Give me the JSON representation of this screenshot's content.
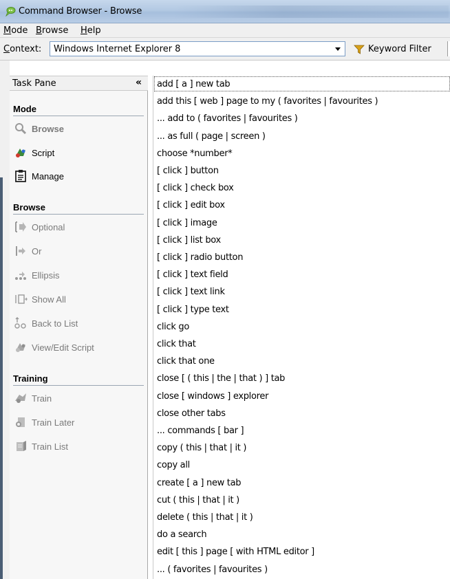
{
  "window": {
    "title": "Command Browser - Browse"
  },
  "menubar": {
    "items": [
      {
        "label": "Mode",
        "accel": "M",
        "rest": "ode"
      },
      {
        "label": "Browse",
        "accel": "B",
        "rest": "rowse"
      },
      {
        "label": "Help",
        "accel": "H",
        "rest": "elp"
      }
    ]
  },
  "contextbar": {
    "label_accel": "C",
    "label_rest": "ontext:",
    "selected_value": "Windows Internet Explorer 8",
    "filter_label": "Keyword Filter"
  },
  "taskpane": {
    "header": "Task Pane",
    "collapse_glyph": "«",
    "sections": [
      {
        "title": "Mode",
        "items": [
          {
            "label": "Browse",
            "icon": "magnifier-icon",
            "state": "bold-disabled"
          },
          {
            "label": "Script",
            "icon": "script-icon",
            "state": "enabled"
          },
          {
            "label": "Manage",
            "icon": "manage-icon",
            "state": "enabled"
          }
        ]
      },
      {
        "title": "Browse",
        "items": [
          {
            "label": "Optional",
            "icon": "optional-icon",
            "state": "disabled"
          },
          {
            "label": "Or",
            "icon": "or-icon",
            "state": "disabled"
          },
          {
            "label": "Ellipsis",
            "icon": "ellipsis-icon",
            "state": "disabled"
          },
          {
            "label": "Show All",
            "icon": "show-all-icon",
            "state": "disabled"
          },
          {
            "label": "Back to List",
            "icon": "back-to-list-icon",
            "state": "disabled"
          },
          {
            "label": "View/Edit Script",
            "icon": "view-edit-script-icon",
            "state": "disabled"
          }
        ]
      },
      {
        "title": "Training",
        "items": [
          {
            "label": "Train",
            "icon": "train-icon",
            "state": "disabled"
          },
          {
            "label": "Train Later",
            "icon": "train-later-icon",
            "state": "disabled"
          },
          {
            "label": "Train List",
            "icon": "train-list-icon",
            "state": "disabled"
          }
        ]
      }
    ]
  },
  "commands": [
    "add [ a ] new tab",
    "add this [ web ] page to my ( favorites | favourites )",
    "... add to ( favorites | favourites )",
    "... as full ( page | screen )",
    "choose *number*",
    "[ click ] button",
    "[ click ] check box",
    "[ click ] edit box",
    "[ click ] image",
    "[ click ] list box",
    "[ click ] radio button",
    "[ click ] text field",
    "[ click ] text link",
    "[ click ] type text",
    "click go",
    "click that",
    "click that one",
    "close [ ( this | the | that ) ] tab",
    "close [ windows ] explorer",
    "close other tabs",
    "... commands [ bar ]",
    "copy ( this | that | it )",
    "copy all",
    "create [ a ] new tab",
    "cut ( this | that | it )",
    "delete ( this | that | it )",
    "do a search",
    "edit [ this ] page [ with HTML editor ]",
    "... ( favorites | favourites )"
  ],
  "colors": {
    "accent": "#7a9cc6",
    "titlebar": "#b3c9e3",
    "disabled_text": "#7a7a7a"
  }
}
